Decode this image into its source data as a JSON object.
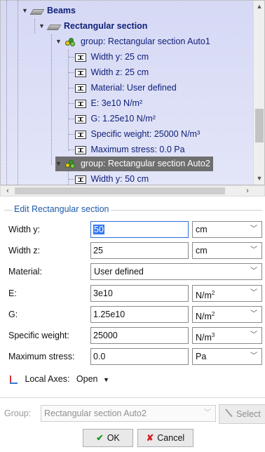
{
  "tree": {
    "items": [
      {
        "label": "Beams",
        "icon": "beam-icon",
        "bold": true
      },
      {
        "label": "Rectangular section",
        "icon": "beam-icon",
        "bold": true
      },
      {
        "label": "group: Rectangular section Auto1",
        "icon": "group-icon"
      },
      {
        "label": "Width y: 25 cm",
        "icon": "property-icon"
      },
      {
        "label": "Width z: 25 cm",
        "icon": "property-icon"
      },
      {
        "label": "Material: User defined",
        "icon": "property-icon"
      },
      {
        "label": "E: 3e10 N/m²",
        "icon": "property-icon"
      },
      {
        "label": "G: 1.25e10 N/m²",
        "icon": "property-icon"
      },
      {
        "label": "Specific weight: 25000 N/m³",
        "icon": "property-icon"
      },
      {
        "label": "Maximum stress: 0.0 Pa",
        "icon": "property-icon"
      },
      {
        "label": "group: Rectangular section Auto2",
        "icon": "group-icon",
        "selected": true
      },
      {
        "label": "Width y: 50 cm",
        "icon": "property-icon"
      }
    ]
  },
  "edit": {
    "title": "Edit Rectangular section",
    "fields": {
      "width_y": {
        "label": "Width y:",
        "value": "50",
        "unit": "cm"
      },
      "width_z": {
        "label": "Width z:",
        "value": "25",
        "unit": "cm"
      },
      "material": {
        "label": "Material:",
        "value": "User defined"
      },
      "e": {
        "label": "E:",
        "value": "3e10",
        "unit": "N/m",
        "unit_exp": "2"
      },
      "g": {
        "label": "G:",
        "value": "1.25e10",
        "unit": "N/m",
        "unit_exp": "2"
      },
      "specific_weight": {
        "label": "Specific weight:",
        "value": "25000",
        "unit": "N/m",
        "unit_exp": "3"
      },
      "max_stress": {
        "label": "Maximum stress:",
        "value": "0.0",
        "unit": "Pa"
      }
    },
    "local_axes": {
      "label": "Local Axes:",
      "value": "Open"
    }
  },
  "group": {
    "label": "Group:",
    "value": "Rectangular section Auto2",
    "select_label": "Select"
  },
  "buttons": {
    "ok": "OK",
    "cancel": "Cancel"
  },
  "icons": {
    "dropdown": "chevron-down-icon",
    "ok": "checkmark-icon",
    "cancel": "x-icon"
  },
  "colors": {
    "selection": "#6f6f6f",
    "tree_bg": "#d6d9f5",
    "title_blue": "#1f5aa8",
    "ok_green": "#1e9a1e",
    "cancel_red": "#d11f1f"
  }
}
